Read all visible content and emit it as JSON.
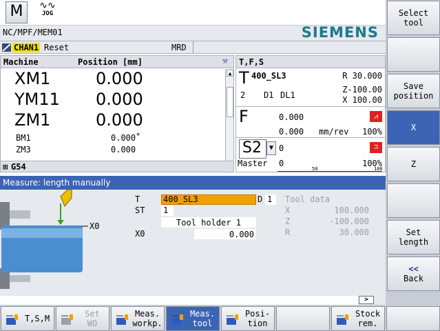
{
  "topbar": {
    "mode_machine_label": "M",
    "mode_jog_label": "JOG"
  },
  "header": {
    "path": "NC/MPF/MEM01",
    "brand": "SIEMENS",
    "channel": "CHAN1",
    "channel_state": "Reset",
    "mrd": "MRD"
  },
  "positions": {
    "col_machine": "Machine",
    "col_position": "Position [mm]",
    "axes": [
      {
        "name": "XM1",
        "value": "0.000",
        "unit": "",
        "size": "big"
      },
      {
        "name": "YM11",
        "value": "0.000",
        "unit": "",
        "size": "big"
      },
      {
        "name": "ZM1",
        "value": "0.000",
        "unit": "",
        "size": "big"
      },
      {
        "name": "BM1",
        "value": "0.000",
        "unit": "°",
        "size": "small"
      },
      {
        "name": "ZM3",
        "value": "0.000",
        "unit": "",
        "size": "small"
      }
    ],
    "work_offset": "G54"
  },
  "tfs": {
    "title": "T,F,S",
    "tool_letter": "T",
    "tool_name": "400_SL3",
    "r_value": "R 30.000",
    "tool_num": "2",
    "d_label": "D1",
    "dl_label": "DL1",
    "z_value": "Z-100.00",
    "x_value": "X 100.00",
    "feed_letter": "F",
    "feed_value1": "0.000",
    "feed_value2": "0.000",
    "feed_unit": "mm/rev",
    "feed_percent": "100%",
    "spindle_name": "S2",
    "spindle_value": "0",
    "spindle_mode": "Master",
    "spindle_speed": "0",
    "spindle_percent": "100%",
    "scale_50": "50",
    "scale_100": "100"
  },
  "measure": {
    "title": "Measure: length manually",
    "x0_tag": "X0",
    "t_label": "T",
    "t_value": "400_SL3",
    "d_label": "D",
    "d_value": "1",
    "st_label": "ST",
    "st_value": "1",
    "holder": "Tool holder 1",
    "x0_label": "X0",
    "x0_value": "0.000",
    "tool_data_label": "Tool data",
    "td_x_label": "X",
    "td_x_value": "100.000",
    "td_z_label": "Z",
    "td_z_value": "-100.000",
    "td_r_label": "R",
    "td_r_value": "30.000",
    "more_arrow": ">"
  },
  "right_softkeys": [
    {
      "label1": "Select",
      "label2": "tool",
      "active": false
    },
    {
      "label1": "",
      "label2": "",
      "active": false
    },
    {
      "label1": "Save",
      "label2": "position",
      "active": false
    },
    {
      "label1": "X",
      "label2": "",
      "active": true
    },
    {
      "label1": "Z",
      "label2": "",
      "active": false
    },
    {
      "label1": "",
      "label2": "",
      "active": false
    },
    {
      "label1": "Set",
      "label2": "length",
      "active": false
    },
    {
      "label1": "<<",
      "label2": "Back",
      "active": false
    },
    {
      "label1": "",
      "label2": "",
      "active": false
    }
  ],
  "bottom_softkeys": [
    {
      "label1": "T,S,M",
      "label2": "",
      "icon": "tsm-icon"
    },
    {
      "label1": "Set",
      "label2": "WO",
      "icon": "set-wo-icon"
    },
    {
      "label1": "Meas.",
      "label2": "workp.",
      "icon": "measure-workpiece-icon"
    },
    {
      "label1": "Meas.",
      "label2": "tool",
      "icon": "measure-tool-icon"
    },
    {
      "label1": "Posi-",
      "label2": "tion",
      "icon": "position-icon"
    },
    {
      "label1": "",
      "label2": "",
      "icon": ""
    },
    {
      "label1": "Stock",
      "label2": "rem.",
      "icon": "stock-removal-icon"
    },
    {
      "label1": "",
      "label2": "",
      "icon": ""
    }
  ],
  "colors": {
    "accent": "#3c64b4",
    "brand": "#1c7a8c",
    "channel_highlight": "#f0e000",
    "tool_field": "#f0a000",
    "alert": "#e02020"
  }
}
